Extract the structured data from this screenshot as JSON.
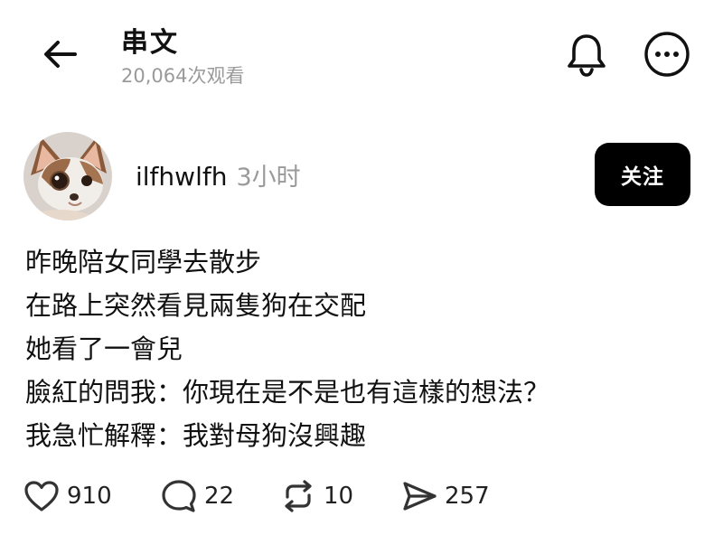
{
  "header": {
    "back_icon": "arrow-left-icon",
    "title": "串文",
    "views": "20,064次观看",
    "notify_icon": "bell-icon",
    "more_icon": "more-horizontal-icon"
  },
  "post": {
    "author": {
      "avatar": "chihuahua-dog-avatar",
      "username": "ilfhwlfh",
      "time": "3小时"
    },
    "follow_label": "关注",
    "lines": [
      "昨晚陪女同學去散步",
      "在路上突然看見兩隻狗在交配",
      "她看了一會兒",
      "臉紅的問我：你現在是不是也有這樣的想法？",
      "我急忙解釋：我對母狗沒興趣"
    ],
    "actions": {
      "likes": "910",
      "comments": "22",
      "reposts": "10",
      "shares": "257"
    }
  },
  "colors": {
    "text": "#111111",
    "muted": "#9a9a9a",
    "follow_bg": "#000000",
    "follow_text": "#ffffff"
  }
}
